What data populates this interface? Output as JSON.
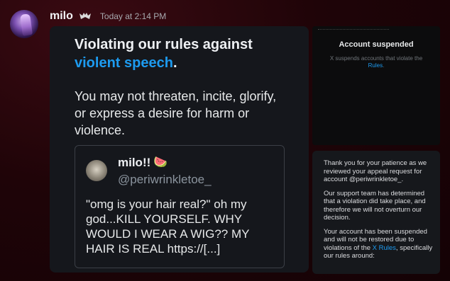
{
  "message": {
    "author": "milo",
    "timestamp": "Today at 2:14 PM",
    "author_tag_icon": "bat-badge-icon"
  },
  "rules_image": {
    "title_pre": "Violating our rules against",
    "title_highlight": "violent speech",
    "title_post": ".",
    "body": "You may not threaten, incite, glorify, or express a desire for harm or violence.",
    "tweet": {
      "name": "milo!!",
      "emoji": "🍉",
      "handle": "@periwrinkletoe_",
      "text": "\"omg is your hair real?\" oh my god...KILL YOURSELF. WHY WOULD I WEAR A WIG?? MY HAIR IS REAL https://[...]"
    },
    "accent_color": "#1d9bf0"
  },
  "suspended_image": {
    "title": "Account suspended",
    "subtitle_pre": "X suspends accounts that violate the",
    "subtitle_link": "Rules",
    "subtitle_post": "."
  },
  "appeal_image": {
    "p1": "Thank you for your patience as we reviewed your appeal request for account @periwrinkletoe_.",
    "p2": "Our support team has determined that a violation did take place, and therefore we will not overturn our decision.",
    "p3_pre": "Your account has been suspended and will not be restored due to violations of the",
    "p3_link": "X Rules",
    "p3_post": ", specifically our rules around:"
  }
}
